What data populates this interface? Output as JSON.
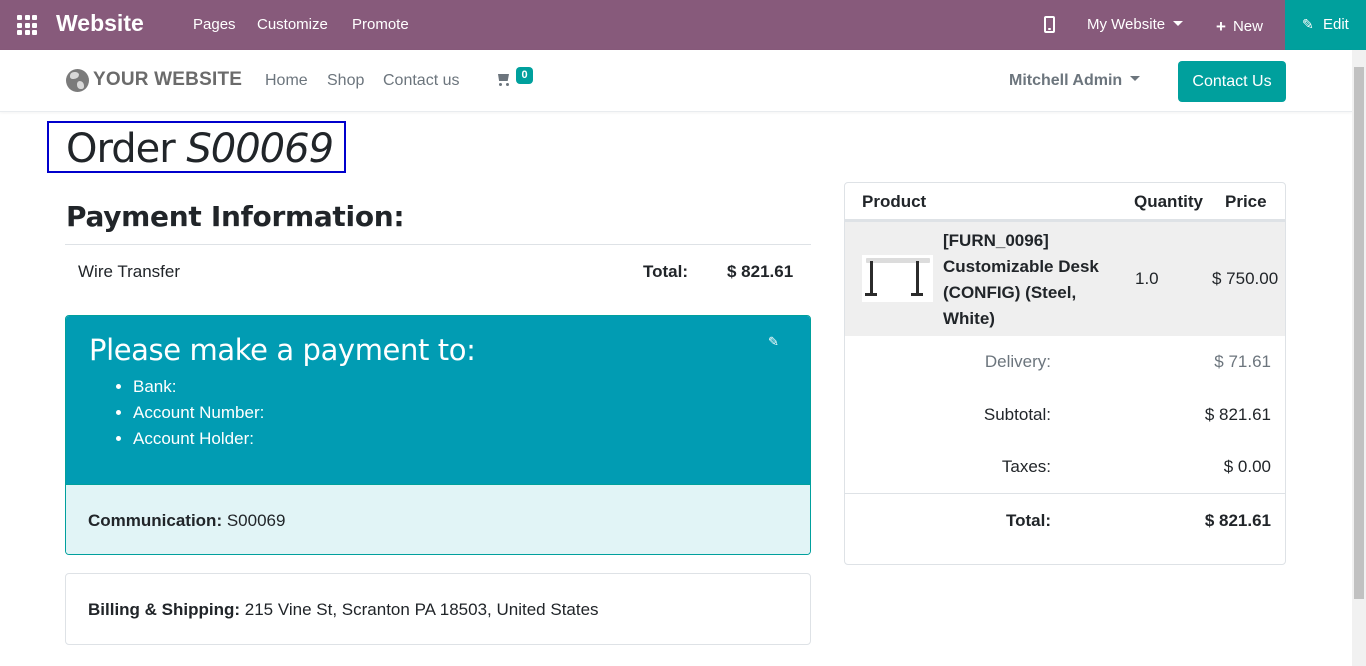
{
  "topbar": {
    "brand": "Website",
    "menu": [
      "Pages",
      "Customize",
      "Promote"
    ],
    "my_website": "My Website",
    "new_label": "New",
    "edit_label": "Edit"
  },
  "header": {
    "logo_text": "YOUR WEBSITE",
    "nav": [
      "Home",
      "Shop",
      "Contact us"
    ],
    "cart_count": "0",
    "user": "Mitchell Admin",
    "contact_button": "Contact Us"
  },
  "order": {
    "title_prefix": "Order",
    "number": "S00069"
  },
  "payment": {
    "heading": "Payment Information:",
    "method": "Wire Transfer",
    "total_label": "Total:",
    "total_value": "$ 821.61",
    "box_heading": "Please make a payment to:",
    "box_items": [
      "Bank:",
      "Account Number:",
      "Account Holder:"
    ],
    "communication_label": "Communication:",
    "communication_value": "S00069"
  },
  "billing": {
    "label": "Billing & Shipping:",
    "address": "215 Vine St, Scranton PA 18503, United States"
  },
  "summary": {
    "columns": [
      "Product",
      "Quantity",
      "Price"
    ],
    "product": {
      "name_lines": [
        "[FURN_0096]",
        "Customizable Desk",
        "(CONFIG) (Steel,",
        "White)"
      ],
      "quantity": "1.0",
      "price": "$ 750.00"
    },
    "delivery_label": "Delivery:",
    "delivery_value": "$ 71.61",
    "subtotal_label": "Subtotal:",
    "subtotal_value": "$ 821.61",
    "taxes_label": "Taxes:",
    "taxes_value": "$ 0.00",
    "total_label": "Total:",
    "total_value": "$ 821.61"
  },
  "colors": {
    "topbar": "#875a7b",
    "accent": "#00a09d",
    "payment_box": "#019cb3"
  }
}
